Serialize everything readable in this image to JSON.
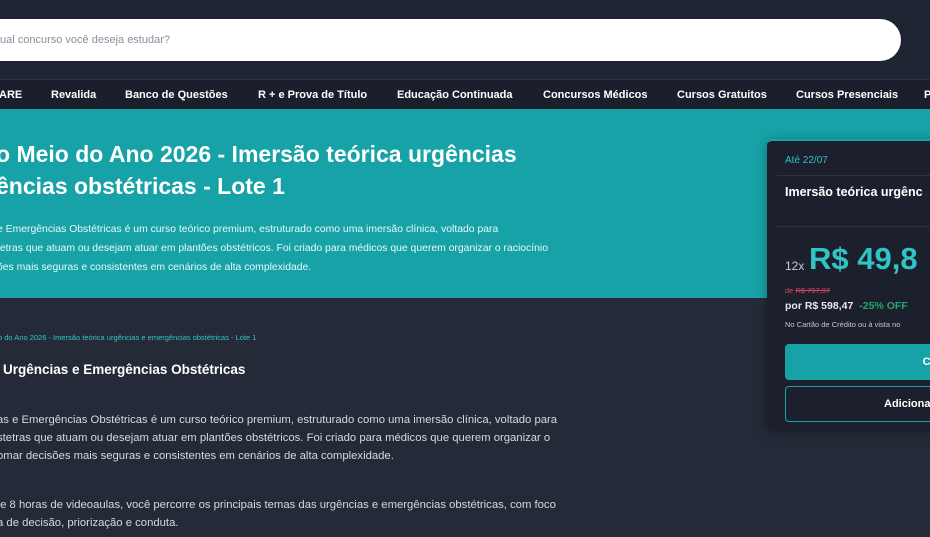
{
  "search": {
    "placeholder": "ual concurso você deseja estudar?"
  },
  "nav": {
    "items": [
      {
        "label": "ARE"
      },
      {
        "label": "Revalida"
      },
      {
        "label": "Banco de Questões"
      },
      {
        "label": "R + e Prova de Título"
      },
      {
        "label": "Educação Continuada"
      },
      {
        "label": "Concursos Médicos"
      },
      {
        "label": "Cursos Gratuitos"
      },
      {
        "label": "Cursos Presenciais"
      },
      {
        "label": "P"
      }
    ]
  },
  "hero": {
    "title_line1": "o Meio do Ano 2026 - Imersão teórica urgências",
    "title_line2": "ências obstétricas - Lote 1",
    "desc_line1": "e Emergências Obstétricas é um curso teórico premium, estruturado como uma imersão clínica, voltado para",
    "desc_line2": "tetras que atuam ou desejam atuar em plantões obstétricos. Foi criado para médicos que querem organizar o raciocínio",
    "desc_line3": "ões mais seguras e consistentes em cenários de alta complexidade."
  },
  "main": {
    "breadcrumb": "o do Ano 2026 - Imersão teórica urgências e emergências obstétricas - Lote 1",
    "section_title": "Urgências e Emergências Obstétricas",
    "p1_line1": "as e Emergências Obstétricas é um curso teórico premium, estruturado como uma imersão clínica, voltado para",
    "p1_line2": "stetras que atuam ou desejam atuar em plantões obstétricos. Foi criado para médicos que querem organizar o",
    "p1_line3": "omar decisões mais seguras e consistentes em cenários de alta complexidade.",
    "p2_line1": "te 8 horas de videoaulas, você percorre os principais temas das urgências e emergências obstétricas, com foco",
    "p2_line2": "a de decisão, priorização e conduta."
  },
  "card": {
    "until": "Até 22/07",
    "title": "Imersão teórica urgênc",
    "installments": "12x",
    "price": "R$ 49,8",
    "from_label": "de",
    "old_price": "R$ 797,97",
    "total_label": "por R$ 598,47",
    "discount": "-25% OFF",
    "note": "No Cartão de Crédito ou à vista no",
    "buy_label": "Co",
    "add_label": "Adiciona"
  }
}
